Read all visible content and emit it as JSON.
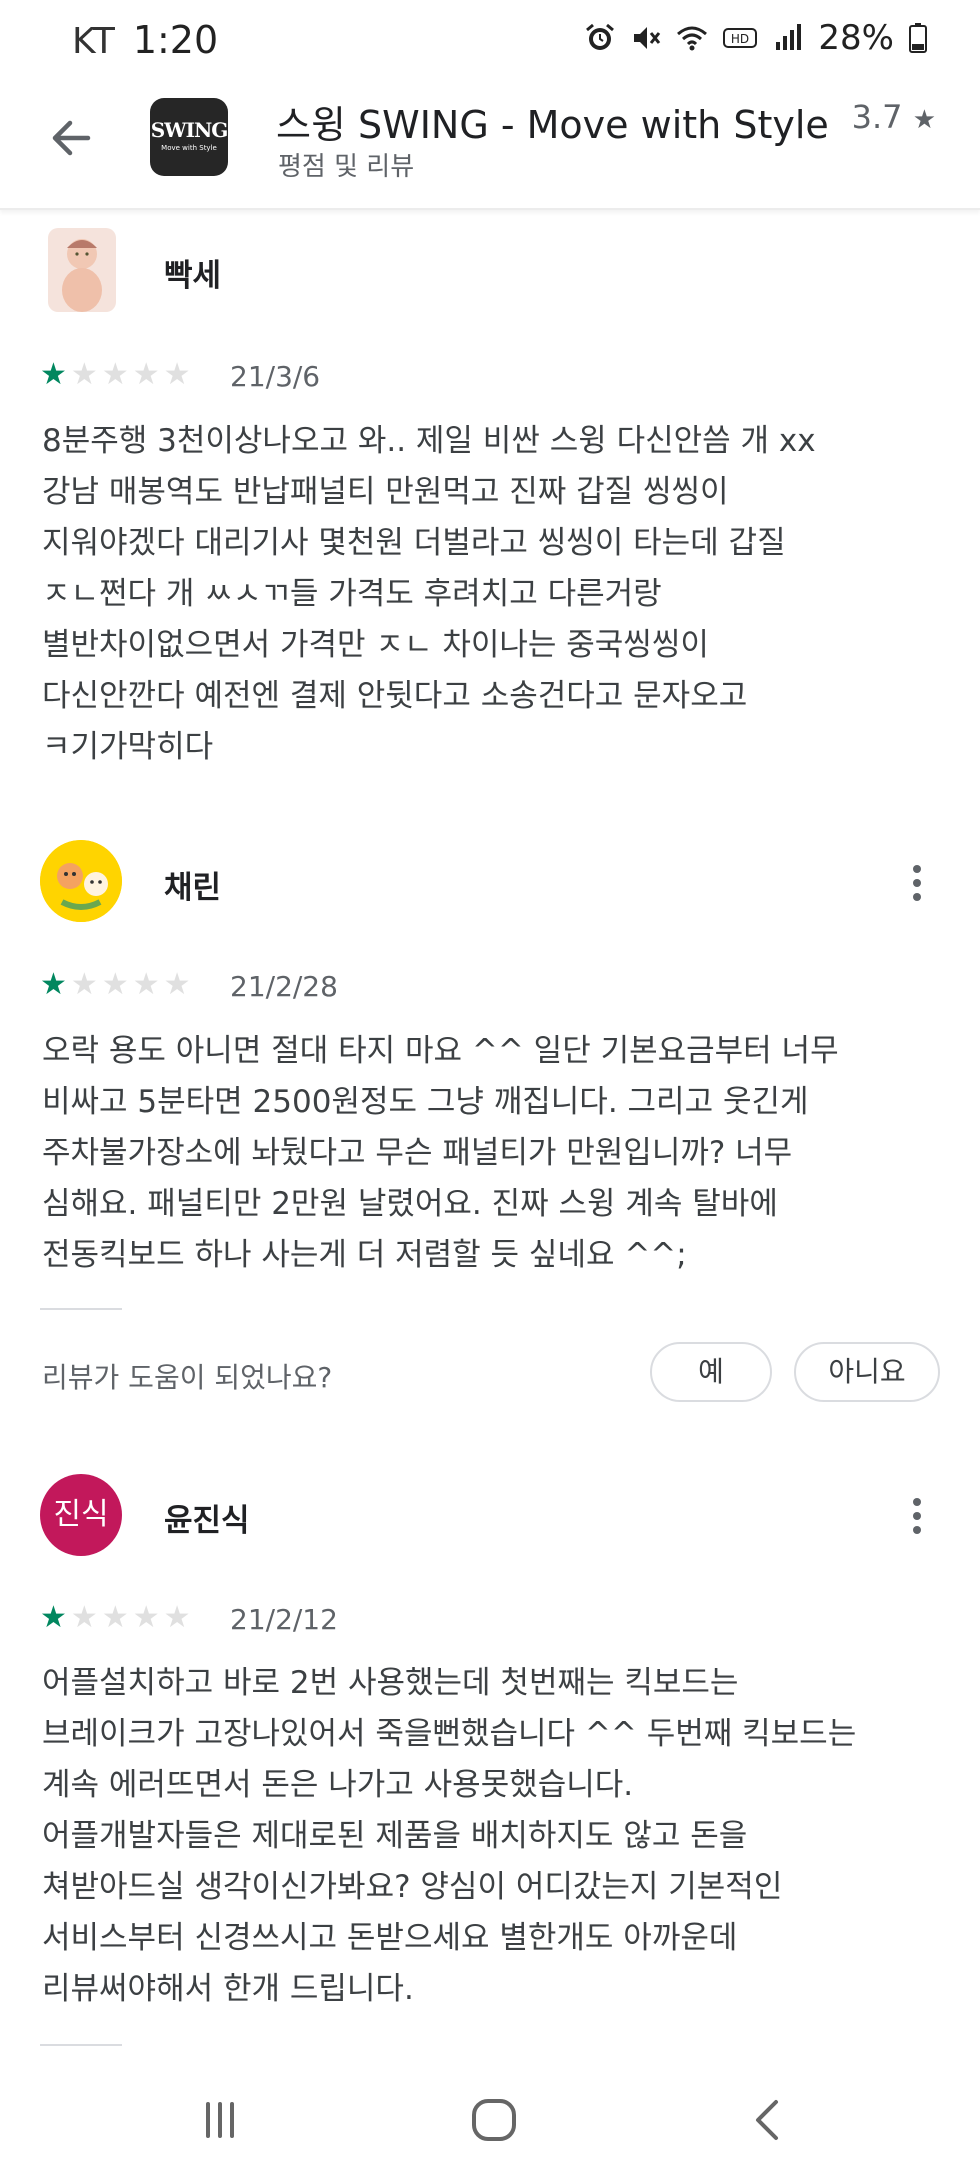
{
  "status": {
    "carrier": "KT",
    "time": "1:20",
    "battery": "28%",
    "icons": [
      "alarm-icon",
      "mute-icon",
      "wifi-icon",
      "hd-icon",
      "signal-icon",
      "battery-icon"
    ]
  },
  "app": {
    "logo_text": "SWING",
    "logo_sub": "Move with Style",
    "title": "스윙 SWING - Move with Style",
    "subtitle": "평점 및 리뷰",
    "rating": "3.7",
    "rating_star": "★"
  },
  "colors": {
    "star_on": "#01875f",
    "star_off": "#e0e0e0",
    "avatar3_bg": "#c2185b"
  },
  "reviews": [
    {
      "name": "빡세",
      "rating": 1,
      "date": "21/3/6",
      "text": "8분주행 3천이상나오고 와.. 제일 비싼 스윙 다신안씀 개 xx\n강남 매봉역도 반납패널티 만원먹고 진짜 갑질 씽씽이\n지워야겠다 대리기사 몇천원 더벌라고 씽씽이 타는데 갑질\nㅈㄴ쩐다 개 ㅆㅅㄲ들 가격도 후려치고 다른거랑\n별반차이없으면서 가격만 ㅈㄴ 차이나는 중국씽씽이\n다신안깐다 예전엔 결제 안뒷다고 소송건다고 문자오고\nㅋ기가막히다"
    },
    {
      "name": "채린",
      "rating": 1,
      "date": "21/2/28",
      "text": "오락 용도 아니면 절대 타지 마요 ^^ 일단 기본요금부터 너무\n비싸고 5분타면 2500원정도 그냥 깨집니다. 그리고 웃긴게\n주차불가장소에 놔뒀다고 무슨 패널티가 만원입니까? 너무\n심해요. 패널티만 2만원 날렸어요. 진짜 스윙 계속 탈바에\n전동킥보드 하나 사는게 더 저렴할 듯 싶네요 ^^;"
    },
    {
      "name": "윤진식",
      "avatar_text": "진식",
      "rating": 1,
      "date": "21/2/12",
      "text": "어플설치하고 바로 2번 사용했는데 첫번째는 킥보드는\n브레이크가 고장나있어서 죽을뻔했습니다 ^^ 두번째 킥보드는\n계속 에러뜨면서 돈은 나가고 사용못했습니다.\n어플개발자들은 제대로된 제품을 배치하지도 않고 돈을\n쳐받아드실 생각이신가봐요? 양심이 어디갔는지 기본적인\n서비스부터 신경쓰시고 돈받으세요 별한개도 아까운데\n리뷰써야해서 한개 드립니다."
    }
  ],
  "helpful": {
    "question": "리뷰가 도움이 되었나요?",
    "yes": "예",
    "no": "아니요"
  },
  "nav": [
    "recent-apps-icon",
    "home-icon",
    "back-icon"
  ]
}
